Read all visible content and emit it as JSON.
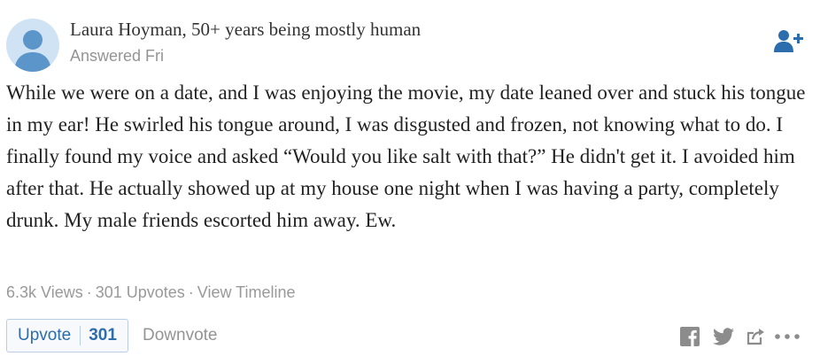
{
  "author": {
    "name_credential": "Laura Hoyman, 50+ years being mostly human",
    "answered": "Answered Fri",
    "avatar_icon": "user-silhouette-icon"
  },
  "follow": {
    "icon": "add-user-icon"
  },
  "answer": {
    "text": "While we were on a date, and I was enjoying the movie, my date leaned over and stuck his tongue in my ear! He swirled his tongue around, I was disgusted and frozen, not knowing what to do. I finally found my voice and asked “Would you like salt with that?” He didn't get it. I avoided him after that. He actually showed up at my house one night when I was having a party, completely drunk. My male friends escorted him away. Ew."
  },
  "stats": {
    "views": "6.3k Views",
    "separator": "·",
    "upvotes": "301 Upvotes",
    "timeline_link": "View Timeline"
  },
  "actions": {
    "upvote_label": "Upvote",
    "upvote_count": "301",
    "downvote_label": "Downvote",
    "share_icons": [
      "facebook-icon",
      "twitter-icon",
      "share-icon",
      "more-icon"
    ]
  },
  "colors": {
    "accent": "#2b6dad",
    "muted_text": "#949494",
    "icon_gray": "#8c8c8c"
  }
}
